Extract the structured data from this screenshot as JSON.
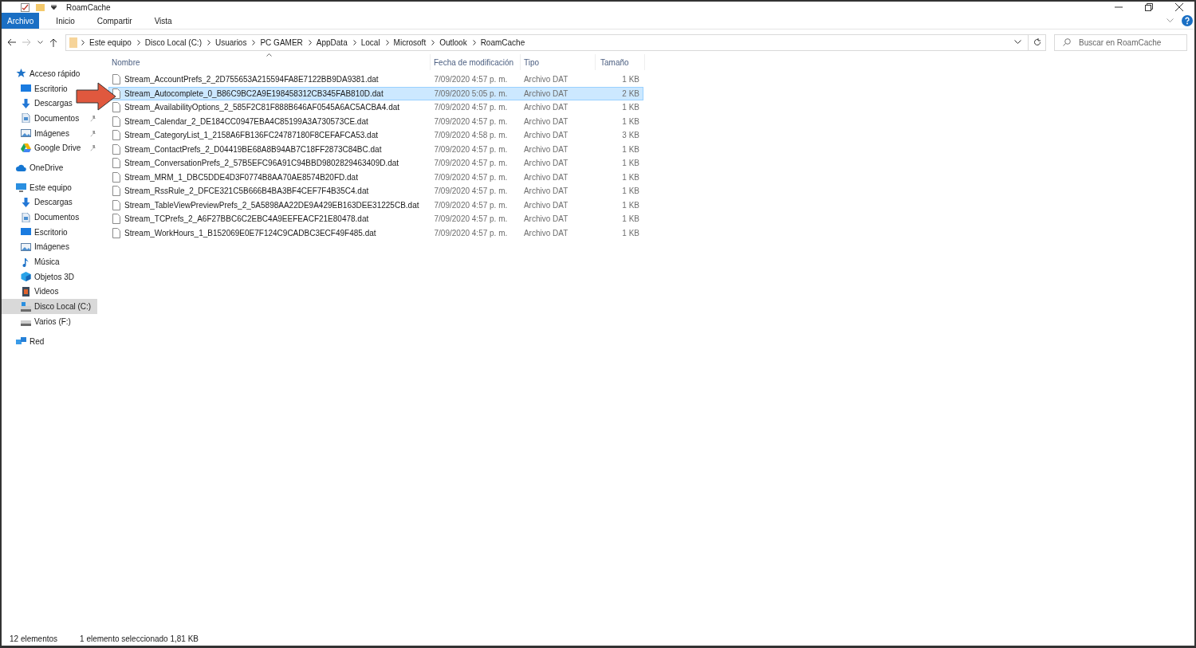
{
  "window": {
    "title": "RoamCache"
  },
  "ribbon_tabs": [
    {
      "label": "Archivo",
      "selected": true
    },
    {
      "label": "Inicio",
      "selected": false
    },
    {
      "label": "Compartir",
      "selected": false
    },
    {
      "label": "Vista",
      "selected": false
    }
  ],
  "address_bar": {
    "path": [
      "Este equipo",
      "Disco Local (C:)",
      "Usuarios",
      "PC GAMER",
      "AppData",
      "Local",
      "Microsoft",
      "Outlook",
      "RoamCache"
    ]
  },
  "search": {
    "placeholder": "Buscar en RoamCache"
  },
  "sidebar": {
    "items": [
      {
        "label": "Acceso rápido",
        "kind": "star",
        "selected": false,
        "children": [
          {
            "label": "Escritorio",
            "kind": "desktop",
            "selected": false,
            "pinned": false
          },
          {
            "label": "Descargas",
            "kind": "download",
            "selected": false,
            "pinned": false
          },
          {
            "label": "Documentos",
            "kind": "document",
            "selected": false,
            "pinned": true
          },
          {
            "label": "Imágenes",
            "kind": "image",
            "selected": false,
            "pinned": true
          },
          {
            "label": "Google Drive",
            "kind": "drive",
            "selected": false,
            "pinned": true
          }
        ]
      },
      {
        "label": "OneDrive",
        "kind": "cloud",
        "selected": false
      },
      {
        "label": "Este equipo",
        "kind": "computer",
        "selected": false,
        "children": [
          {
            "label": "Descargas",
            "kind": "download",
            "selected": false,
            "pinned": false
          },
          {
            "label": "Documentos",
            "kind": "document",
            "selected": false,
            "pinned": false
          },
          {
            "label": "Escritorio",
            "kind": "desktop",
            "selected": false,
            "pinned": false
          },
          {
            "label": "Imágenes",
            "kind": "image",
            "selected": false,
            "pinned": false
          },
          {
            "label": "Música",
            "kind": "music",
            "selected": false,
            "pinned": false
          },
          {
            "label": "Objetos 3D",
            "kind": "cube",
            "selected": false,
            "pinned": false
          },
          {
            "label": "Videos",
            "kind": "video",
            "selected": false,
            "pinned": false
          },
          {
            "label": "Disco Local (C:)",
            "kind": "disk",
            "selected": true,
            "pinned": false
          },
          {
            "label": "Varios (F:)",
            "kind": "disk",
            "selected": false,
            "pinned": false
          }
        ]
      },
      {
        "label": "Red",
        "kind": "network",
        "selected": false
      }
    ]
  },
  "table": {
    "columns": [
      "Nombre",
      "Fecha de modificación",
      "Tipo",
      "Tamaño"
    ],
    "rows": [
      {
        "name": "Stream_AccountPrefs_2_2D755653A215594FA8E7122BB9DA9381.dat",
        "date": "7/09/2020 4:57 p. m.",
        "type": "Archivo DAT",
        "size": "1 KB",
        "selected": false
      },
      {
        "name": "Stream_Autocomplete_0_B86C9BC2A9E198458312CB345FAB810D.dat",
        "date": "7/09/2020 5:05 p. m.",
        "type": "Archivo DAT",
        "size": "2 KB",
        "selected": true
      },
      {
        "name": "Stream_AvailabilityOptions_2_585F2C81F888B646AF0545A6AC5ACBA4.dat",
        "date": "7/09/2020 4:57 p. m.",
        "type": "Archivo DAT",
        "size": "1 KB",
        "selected": false
      },
      {
        "name": "Stream_Calendar_2_DE184CC0947EBA4C85199A3A730573CE.dat",
        "date": "7/09/2020 4:57 p. m.",
        "type": "Archivo DAT",
        "size": "1 KB",
        "selected": false
      },
      {
        "name": "Stream_CategoryList_1_2158A6FB136FC24787180F8CEFAFCA53.dat",
        "date": "7/09/2020 4:58 p. m.",
        "type": "Archivo DAT",
        "size": "3 KB",
        "selected": false
      },
      {
        "name": "Stream_ContactPrefs_2_D04419BE68A8B94AB7C18FF2873C84BC.dat",
        "date": "7/09/2020 4:57 p. m.",
        "type": "Archivo DAT",
        "size": "1 KB",
        "selected": false
      },
      {
        "name": "Stream_ConversationPrefs_2_57B5EFC96A91C94BBD9802829463409D.dat",
        "date": "7/09/2020 4:57 p. m.",
        "type": "Archivo DAT",
        "size": "1 KB",
        "selected": false
      },
      {
        "name": "Stream_MRM_1_DBC5DDE4D3F0774B8AA70AE8574B20FD.dat",
        "date": "7/09/2020 4:57 p. m.",
        "type": "Archivo DAT",
        "size": "1 KB",
        "selected": false
      },
      {
        "name": "Stream_RssRule_2_DFCE321C5B666B4BA3BF4CEF7F4B35C4.dat",
        "date": "7/09/2020 4:57 p. m.",
        "type": "Archivo DAT",
        "size": "1 KB",
        "selected": false
      },
      {
        "name": "Stream_TableViewPreviewPrefs_2_5A5898AA22DE9A429EB163DEE31225CB.dat",
        "date": "7/09/2020 4:57 p. m.",
        "type": "Archivo DAT",
        "size": "1 KB",
        "selected": false
      },
      {
        "name": "Stream_TCPrefs_2_A6F27BBC6C2EBC4A9EEFEACF21E80478.dat",
        "date": "7/09/2020 4:57 p. m.",
        "type": "Archivo DAT",
        "size": "1 KB",
        "selected": false
      },
      {
        "name": "Stream_WorkHours_1_B152069E0E7F124C9CADBC3ECF49F485.dat",
        "date": "7/09/2020 4:57 p. m.",
        "type": "Archivo DAT",
        "size": "1 KB",
        "selected": false
      }
    ]
  },
  "status_bar": {
    "count": "12 elementos",
    "selection": "1 elemento seleccionado  1,81 KB"
  }
}
